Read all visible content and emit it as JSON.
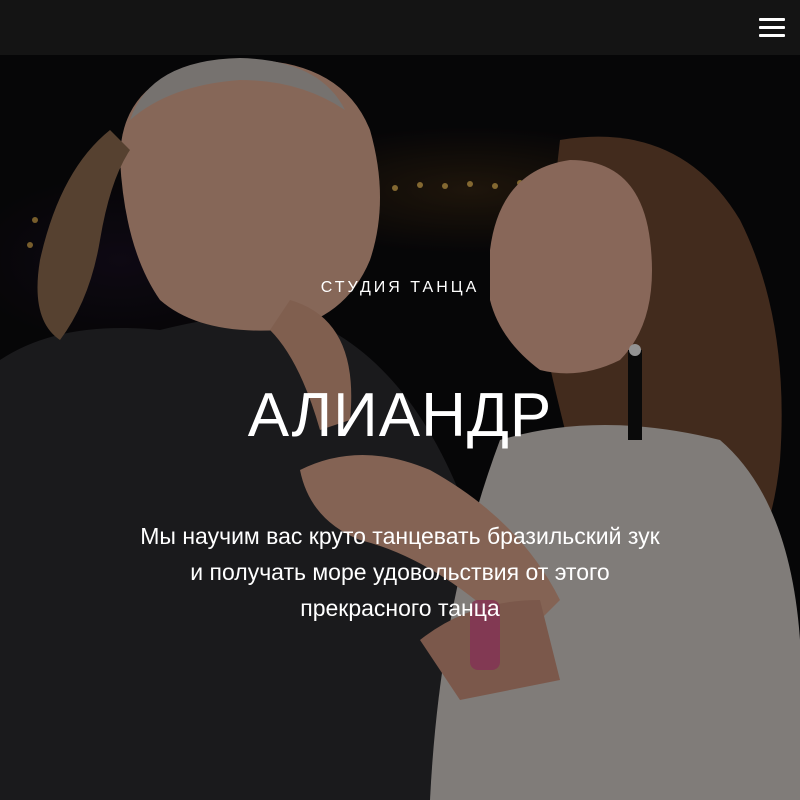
{
  "header": {
    "menu_icon": "hamburger-menu-icon"
  },
  "hero": {
    "eyebrow": "СТУДИЯ ТАНЦА",
    "title": "АЛИАНДР",
    "subtitle_lines": [
      "Мы научим вас круто танцевать бразильский зук",
      "и получать море удовольствия от этого",
      "прекрасного танца"
    ]
  },
  "colors": {
    "header_bg": "#141414",
    "text": "#ffffff",
    "overlay": "rgba(0,0,0,0.38)"
  }
}
